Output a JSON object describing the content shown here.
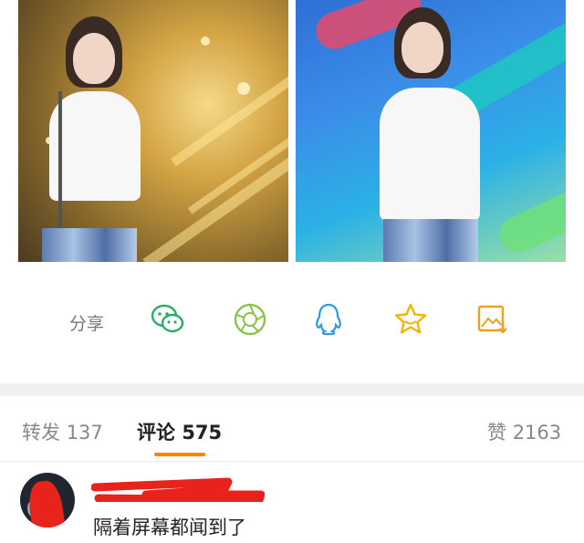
{
  "photos": [
    {
      "description_icon": "photo-icon"
    },
    {
      "description_icon": "photo-icon"
    }
  ],
  "share": {
    "label": "分享",
    "targets": [
      {
        "name": "wechat",
        "icon": "wechat-icon",
        "color": "#2aae67"
      },
      {
        "name": "moments",
        "icon": "moments-aperture-icon",
        "color": "#8bc34a"
      },
      {
        "name": "qq",
        "icon": "qq-penguin-icon",
        "color": "#2b9be8"
      },
      {
        "name": "qzone",
        "icon": "star-icon",
        "color": "#f5b400"
      },
      {
        "name": "save-image",
        "icon": "save-image-icon",
        "color": "#f0a020"
      }
    ]
  },
  "stats": {
    "repost_label": "转发",
    "repost_count": "137",
    "comment_label": "评论",
    "comment_count": "575",
    "like_label": "赞",
    "like_count": "2163",
    "accent": "#ff8200"
  },
  "comment": {
    "text": "隔着屏幕都闻到了"
  }
}
